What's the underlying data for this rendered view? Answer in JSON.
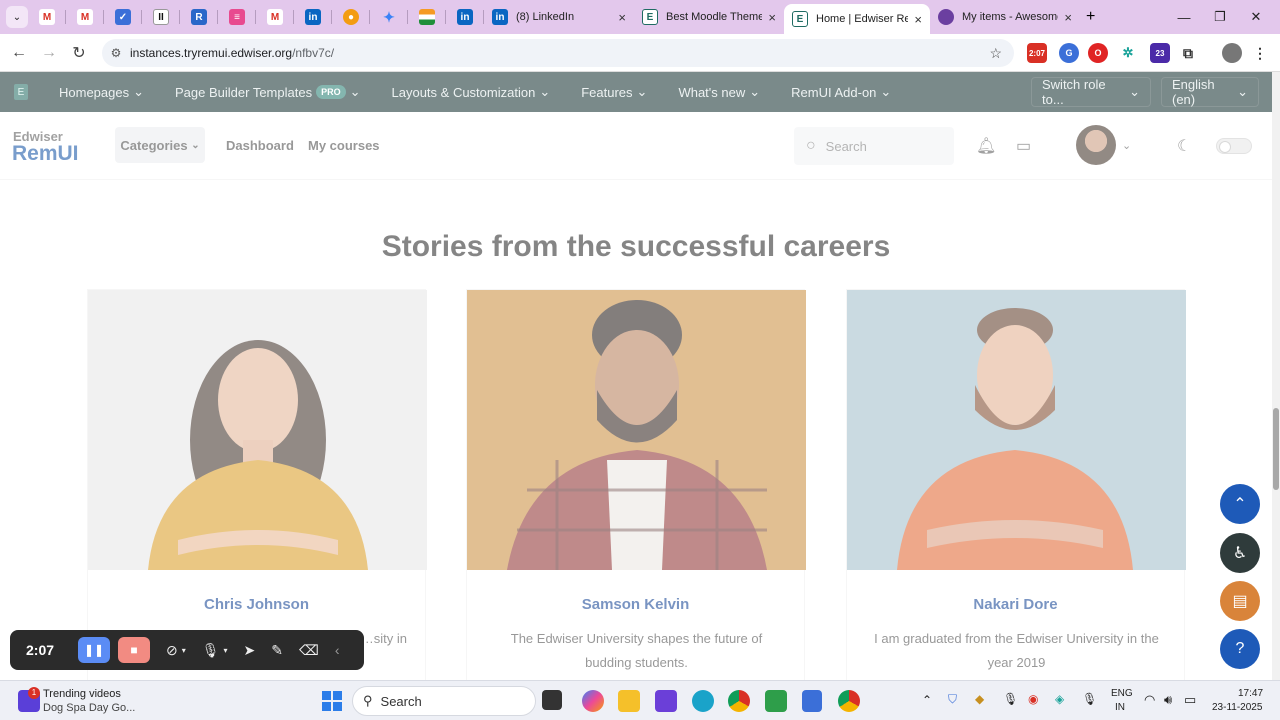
{
  "browser": {
    "tabs": [
      {
        "title": "(8) LinkedIn",
        "active": false
      },
      {
        "title": "Best Moodle Theme",
        "active": false
      },
      {
        "title": "Home | Edwiser Rem",
        "active": true
      },
      {
        "title": "My items - Awesome",
        "active": false
      }
    ],
    "new_tab": "+",
    "close": "×",
    "url_host": "instances.tryremui.edwiser.org",
    "url_path": "/nfbv7c/",
    "ext_badge_time": "2:07",
    "ext_badge_count": "23"
  },
  "site_nav": {
    "items": [
      {
        "label": "Homepages"
      },
      {
        "label": "Page Builder Templates",
        "badge": "PRO"
      },
      {
        "label": "Layouts & Customization"
      },
      {
        "label": "Features"
      },
      {
        "label": "What's new"
      },
      {
        "label": "RemUI Add-on"
      }
    ],
    "switch_role": "Switch role to...",
    "language": "English (en)"
  },
  "header": {
    "brand_top": "Edwiser",
    "brand_bottom": "RemUI",
    "categories": "Categories",
    "links": [
      "Dashboard",
      "My courses"
    ],
    "search_placeholder": "Search"
  },
  "section": {
    "heading": "Stories from the successful careers",
    "cards": [
      {
        "name": "Chris Johnson",
        "quote": "…sity in",
        "photo_bg": "#e6e6e6",
        "shirt": "#d99a1e"
      },
      {
        "name": "Samson Kelvin",
        "quote": "The Edwiser University shapes the future of budding students.",
        "photo_bg": "#c98a3a",
        "shirt": "#8a2a2a"
      },
      {
        "name": "Nakari Dore",
        "quote": "I am graduated from the Edwiser University in the year 2019",
        "photo_bg": "#9fbcc8",
        "shirt": "#e0622a"
      }
    ]
  },
  "recorder": {
    "time": "2:07"
  },
  "taskbar": {
    "news_title": "Trending videos",
    "news_sub": "Dog Spa Day Go...",
    "news_badge": "1",
    "search": "Search",
    "lang1": "ENG",
    "lang2": "IN",
    "time": "17:47",
    "date": "23-11-2025"
  },
  "colors": {
    "nav_bg": "#0d2a2a",
    "brand_blue": "#0b4ea2",
    "fab_blue": "#1e5ab8"
  }
}
